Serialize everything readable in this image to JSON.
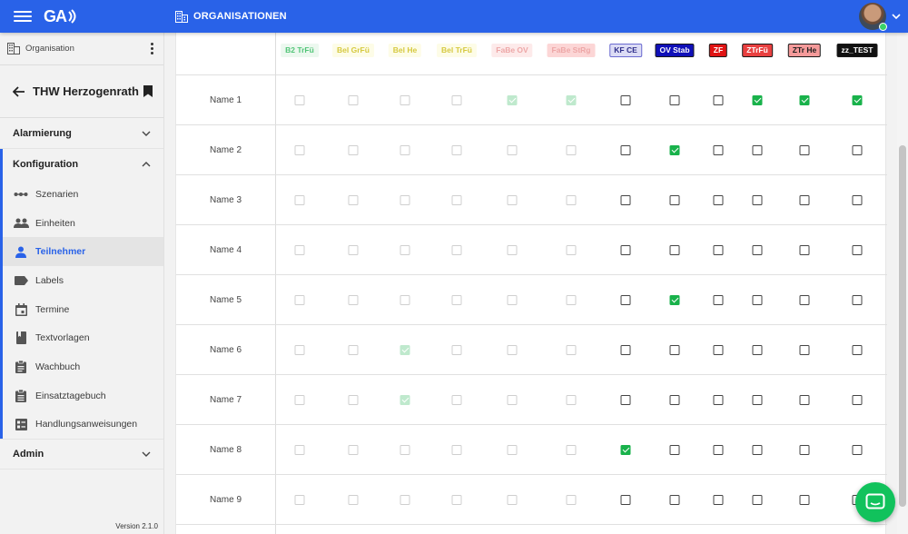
{
  "header": {
    "logo_text": "GA",
    "page_title": "ORGANISATIONEN",
    "brand_color": "#2962e8"
  },
  "sidebar": {
    "org_label": "Organisation",
    "unit_name": "THW Herzogenrath",
    "sections": {
      "alarmierung": "Alarmierung",
      "konfiguration": "Konfiguration",
      "admin": "Admin"
    },
    "items": [
      {
        "label": "Szenarien",
        "icon": "scenarios-icon"
      },
      {
        "label": "Einheiten",
        "icon": "groups-icon"
      },
      {
        "label": "Teilnehmer",
        "icon": "person-icon",
        "active": true
      },
      {
        "label": "Labels",
        "icon": "label-icon"
      },
      {
        "label": "Termine",
        "icon": "calendar-icon"
      },
      {
        "label": "Textvorlagen",
        "icon": "book-icon"
      },
      {
        "label": "Wachbuch",
        "icon": "clipboard-icon"
      },
      {
        "label": "Einsatztagebuch",
        "icon": "clipboard-list-icon"
      },
      {
        "label": "Handlungsanweisungen",
        "icon": "checklist-icon"
      }
    ],
    "version": "Version 2.1.0"
  },
  "labels": [
    {
      "text": "B2 TrFü",
      "color": "#19b24b",
      "bg": "#e6f6ea",
      "disabled": true
    },
    {
      "text": "Bel GrFü",
      "color": "#c9b800",
      "bg": "#fdfbe0",
      "disabled": true
    },
    {
      "text": "Bel He",
      "color": "#c9b800",
      "bg": "#fdfbe0",
      "disabled": true
    },
    {
      "text": "Bel TrFü",
      "color": "#c9b800",
      "bg": "#fdfbe0",
      "disabled": true
    },
    {
      "text": "FaBe OV",
      "color": "#e88a8a",
      "bg": "#fde3e3",
      "disabled": true
    },
    {
      "text": "FaBe StRg",
      "color": "#e88a8a",
      "bg": "#fbc9c9",
      "disabled": true
    },
    {
      "text": "KF CE",
      "color": "#2e2e8a",
      "bg": "#dcdcf5",
      "disabled": false
    },
    {
      "text": "OV Stab",
      "color": "#ffffff",
      "bg": "#1010b8",
      "disabled": false
    },
    {
      "text": "ZF",
      "color": "#ffffff",
      "bg": "#e01414",
      "disabled": false
    },
    {
      "text": "ZTrFü",
      "color": "#ffffff",
      "bg": "#e84040",
      "disabled": false
    },
    {
      "text": "ZTr He",
      "color": "#202020",
      "bg": "#f59a9a",
      "disabled": false
    },
    {
      "text": "zz_TEST",
      "color": "#ffffff",
      "bg": "#111111",
      "disabled": false
    }
  ],
  "participants": [
    {
      "name": "Name 1",
      "checks": [
        0,
        0,
        0,
        0,
        1,
        1,
        0,
        0,
        0,
        1,
        1,
        1
      ]
    },
    {
      "name": "Name 2",
      "checks": [
        0,
        0,
        0,
        0,
        0,
        0,
        0,
        1,
        0,
        0,
        0,
        0
      ]
    },
    {
      "name": "Name 3",
      "checks": [
        0,
        0,
        0,
        0,
        0,
        0,
        0,
        0,
        0,
        0,
        0,
        0
      ]
    },
    {
      "name": "Name 4",
      "checks": [
        0,
        0,
        0,
        0,
        0,
        0,
        0,
        0,
        0,
        0,
        0,
        0
      ]
    },
    {
      "name": "Name 5",
      "checks": [
        0,
        0,
        0,
        0,
        0,
        0,
        0,
        1,
        0,
        0,
        0,
        0
      ]
    },
    {
      "name": "Name 6",
      "checks": [
        0,
        0,
        1,
        0,
        0,
        0,
        0,
        0,
        0,
        0,
        0,
        0
      ]
    },
    {
      "name": "Name 7",
      "checks": [
        0,
        0,
        1,
        0,
        0,
        0,
        0,
        0,
        0,
        0,
        0,
        0
      ]
    },
    {
      "name": "Name 8",
      "checks": [
        0,
        0,
        0,
        0,
        0,
        0,
        1,
        0,
        0,
        0,
        0,
        0
      ]
    },
    {
      "name": "Name 9",
      "checks": [
        0,
        0,
        0,
        0,
        0,
        0,
        0,
        0,
        0,
        0,
        0,
        0
      ]
    }
  ]
}
